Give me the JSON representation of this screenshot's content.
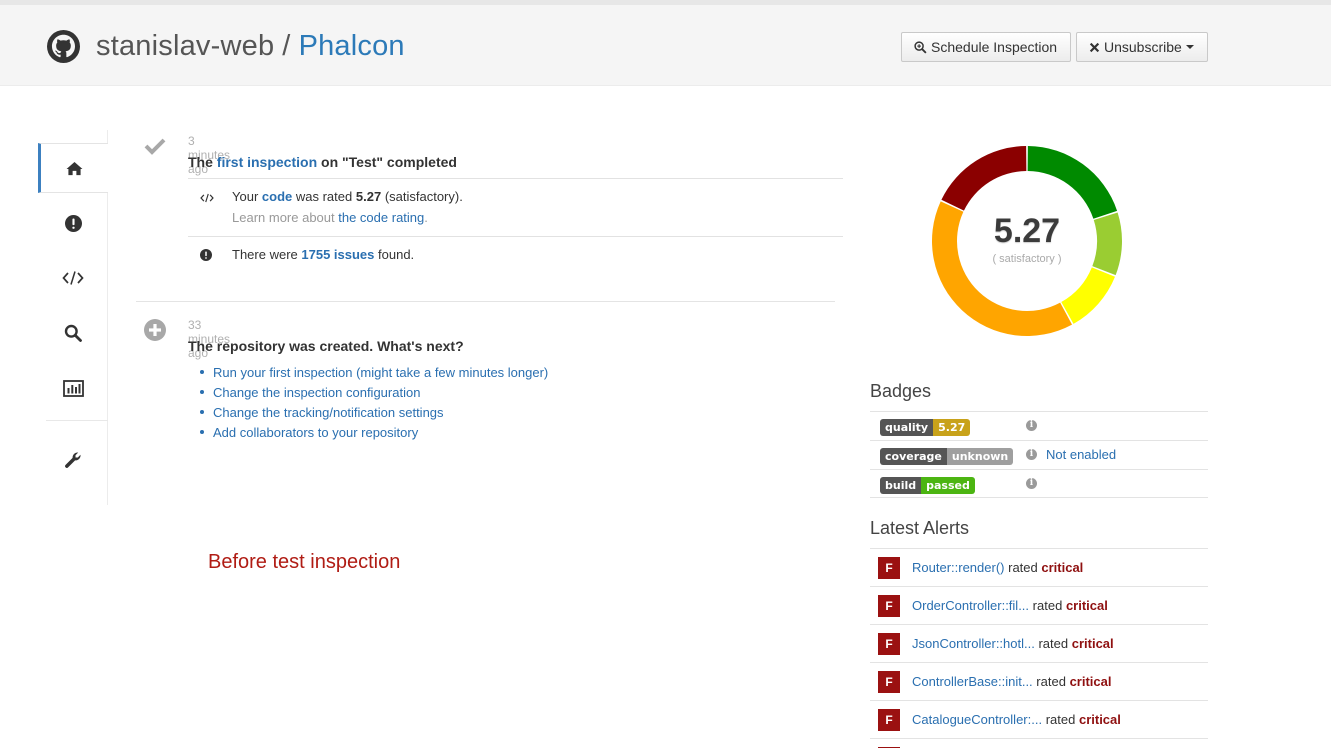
{
  "header": {
    "owner": "stanislav-web",
    "separator": "/",
    "repo": "Phalcon",
    "schedule_label": "Schedule Inspection",
    "unsubscribe_label": "Unsubscribe"
  },
  "sidebar": {
    "items": [
      {
        "name": "home",
        "icon": "home-icon",
        "active": true
      },
      {
        "name": "issues",
        "icon": "exclamation-icon",
        "active": false
      },
      {
        "name": "code",
        "icon": "code-icon",
        "active": false
      },
      {
        "name": "search",
        "icon": "search-icon",
        "active": false
      },
      {
        "name": "statistics",
        "icon": "bar-chart-icon",
        "active": false
      },
      {
        "name": "settings",
        "icon": "wrench-icon",
        "active": false
      }
    ]
  },
  "events": [
    {
      "time": "3 minutes ago",
      "title_prefix": "The",
      "title_link": "first inspection",
      "title_suffix": "on \"Test\" completed",
      "rating": {
        "prefix": "Your",
        "link": "code",
        "middle": "was rated",
        "value": "5.27",
        "suffix": "(satisfactory).",
        "learn_prefix": "Learn more about",
        "learn_link": "the code rating",
        "learn_suffix": "."
      },
      "issues": {
        "prefix": "There were",
        "link": "1755 issues",
        "suffix": "found."
      }
    },
    {
      "time": "33 minutes ago",
      "title": "The repository was created. What's next?",
      "links": [
        "Run your first inspection (might take a few minutes longer)",
        "Change the inspection configuration",
        "Change the tracking/notification settings",
        "Add collaborators to your repository"
      ]
    }
  ],
  "annotation": "Before test inspection",
  "score": {
    "value": "5.27",
    "label": "( satisfactory )",
    "segments": [
      {
        "grade": "A",
        "fraction": 0.2,
        "color": "#008a00"
      },
      {
        "grade": "B",
        "fraction": 0.11,
        "color": "#9acd32"
      },
      {
        "grade": "C",
        "fraction": 0.11,
        "color": "#ffff00"
      },
      {
        "grade": "D",
        "fraction": 0.4,
        "color": "#ffa500"
      },
      {
        "grade": "F",
        "fraction": 0.18,
        "color": "#8b0000"
      }
    ]
  },
  "badges": {
    "title": "Badges",
    "rows": [
      {
        "left": "quality",
        "right": "5.27",
        "color": "#c8a21a",
        "status": ""
      },
      {
        "left": "coverage",
        "right": "unknown",
        "color": "#9f9f9f",
        "status": "Not enabled"
      },
      {
        "left": "build",
        "right": "passed",
        "color": "#4cb512",
        "status": ""
      }
    ]
  },
  "alerts": {
    "title": "Latest Alerts",
    "rated_word": "rated",
    "items": [
      {
        "grade": "F",
        "name": "Router::render()",
        "severity": "critical"
      },
      {
        "grade": "F",
        "name": "OrderController::fil...",
        "severity": "critical"
      },
      {
        "grade": "F",
        "name": "JsonController::hotl...",
        "severity": "critical"
      },
      {
        "grade": "F",
        "name": "ControllerBase::init...",
        "severity": "critical"
      },
      {
        "grade": "F",
        "name": "CatalogueController:...",
        "severity": "critical"
      }
    ]
  }
}
